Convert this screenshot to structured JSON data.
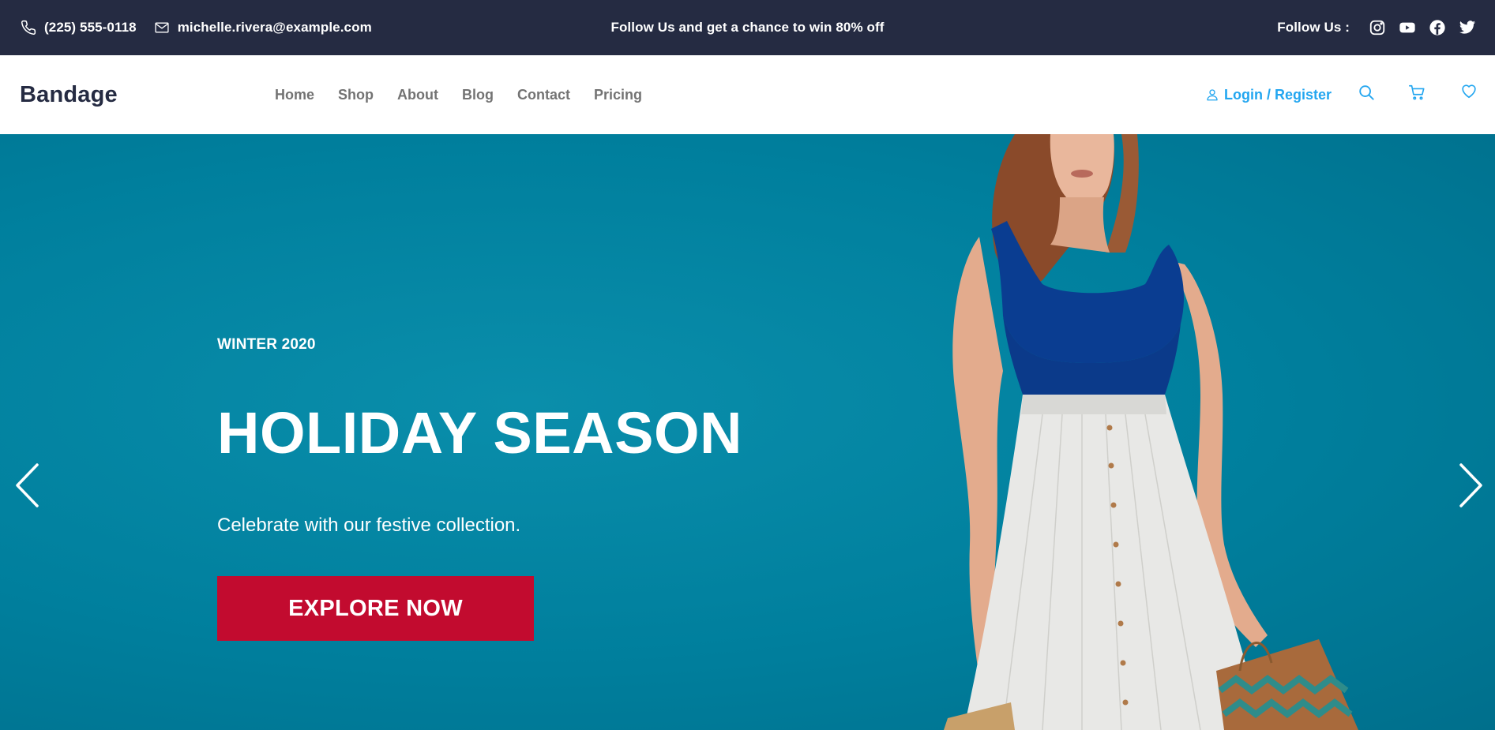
{
  "topbar": {
    "phone": "(225) 555-0118",
    "email": "michelle.rivera@example.com",
    "promo": "Follow Us and get a chance to win 80% off",
    "follow_label": "Follow Us  :",
    "social_icons": [
      "instagram-icon",
      "youtube-icon",
      "facebook-icon",
      "twitter-icon"
    ]
  },
  "nav": {
    "brand": "Bandage",
    "menu": [
      "Home",
      "Shop",
      "About",
      "Blog",
      "Contact",
      "Pricing"
    ],
    "login": "Login / Register",
    "icons": [
      "search-icon",
      "cart-icon",
      "heart-icon"
    ]
  },
  "hero": {
    "season": "WINTER 2020",
    "headline": "HOLIDAY SEASON",
    "subtitle": "Celebrate with our festive collection.",
    "cta": "EXPLORE NOW"
  },
  "colors": {
    "topbar_bg": "#252b42",
    "hero_bg": "#00809e",
    "cta_bg": "#c20b2f",
    "accent": "#23a6f0",
    "menu_text": "#737373"
  }
}
